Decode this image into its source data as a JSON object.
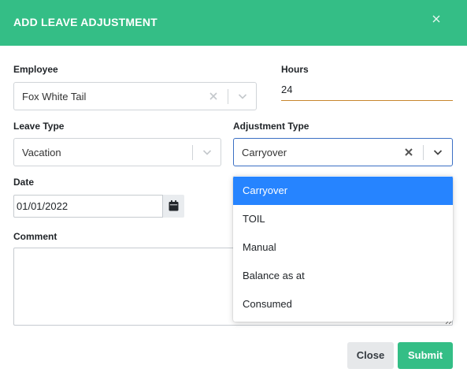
{
  "modal": {
    "title": "ADD LEAVE ADJUSTMENT",
    "close_icon": "close-icon"
  },
  "employee": {
    "label": "Employee",
    "value": "Fox White Tail"
  },
  "hours": {
    "label": "Hours",
    "value": "24"
  },
  "leave_type": {
    "label": "Leave Type",
    "value": "Vacation"
  },
  "adjustment_type": {
    "label": "Adjustment Type",
    "value": "Carryover",
    "options": [
      "Carryover",
      "TOIL",
      "Manual",
      "Balance as at",
      "Consumed"
    ],
    "selected_index": 0
  },
  "date": {
    "label": "Date",
    "value": "01/01/2022",
    "icon": "calendar-icon"
  },
  "comment": {
    "label": "Comment",
    "value": ""
  },
  "buttons": {
    "close": "Close",
    "submit": "Submit"
  },
  "colors": {
    "header": "#34be86",
    "selected_option": "#2684ff",
    "active_border": "#3b6fc4",
    "hours_underline": "#c8862e"
  }
}
